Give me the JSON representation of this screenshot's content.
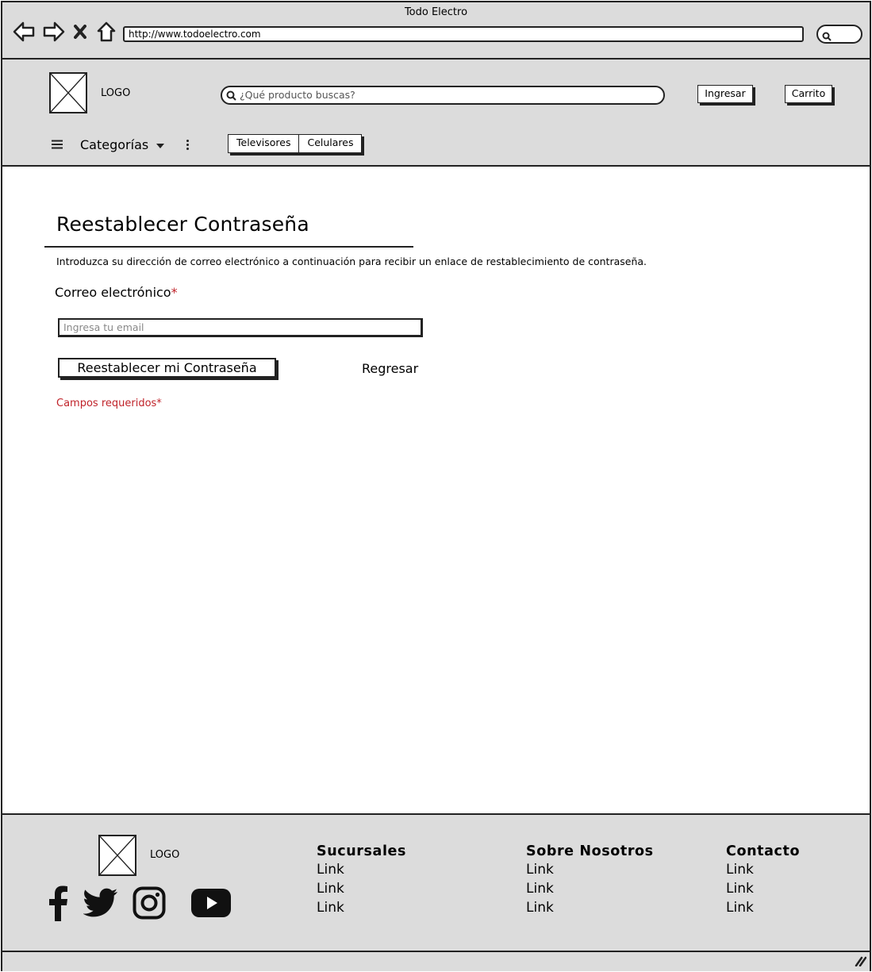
{
  "window": {
    "title": "Todo Electro",
    "url": "http://www.todoelectro.com"
  },
  "header": {
    "logo_label": "LOGO",
    "search_placeholder": "¿Qué producto buscas?",
    "login_label": "Ingresar",
    "cart_label": "Carrito",
    "categories_label": "Categorías",
    "tabs": [
      "Televisores",
      "Celulares"
    ]
  },
  "main": {
    "title": "Reestablecer Contraseña",
    "intro": "Introduzca su dirección de correo electrónico a continuación para recibir un enlace de restablecimiento de contraseña.",
    "email_label": "Correo electrónico",
    "required_mark": "*",
    "email_placeholder": "Ingresa tu email",
    "email_value": "",
    "submit_label": "Reestablecer mi Contraseña",
    "back_label": "Regresar",
    "required_note": "Campos requeridos*"
  },
  "footer": {
    "logo_label": "LOGO",
    "social_icons": [
      "facebook-icon",
      "twitter-icon",
      "instagram-icon",
      "youtube-icon"
    ],
    "columns": [
      {
        "title": "Sucursales",
        "links": [
          "Link",
          "Link",
          "Link"
        ]
      },
      {
        "title": "Sobre Nosotros",
        "links": [
          "Link",
          "Link",
          "Link"
        ]
      },
      {
        "title": "Contacto",
        "links": [
          "Link",
          "Link",
          "Link"
        ]
      }
    ]
  },
  "colors": {
    "chrome_gray": "#dcdcdc",
    "ink": "#222222",
    "required_red": "#c0232a"
  }
}
